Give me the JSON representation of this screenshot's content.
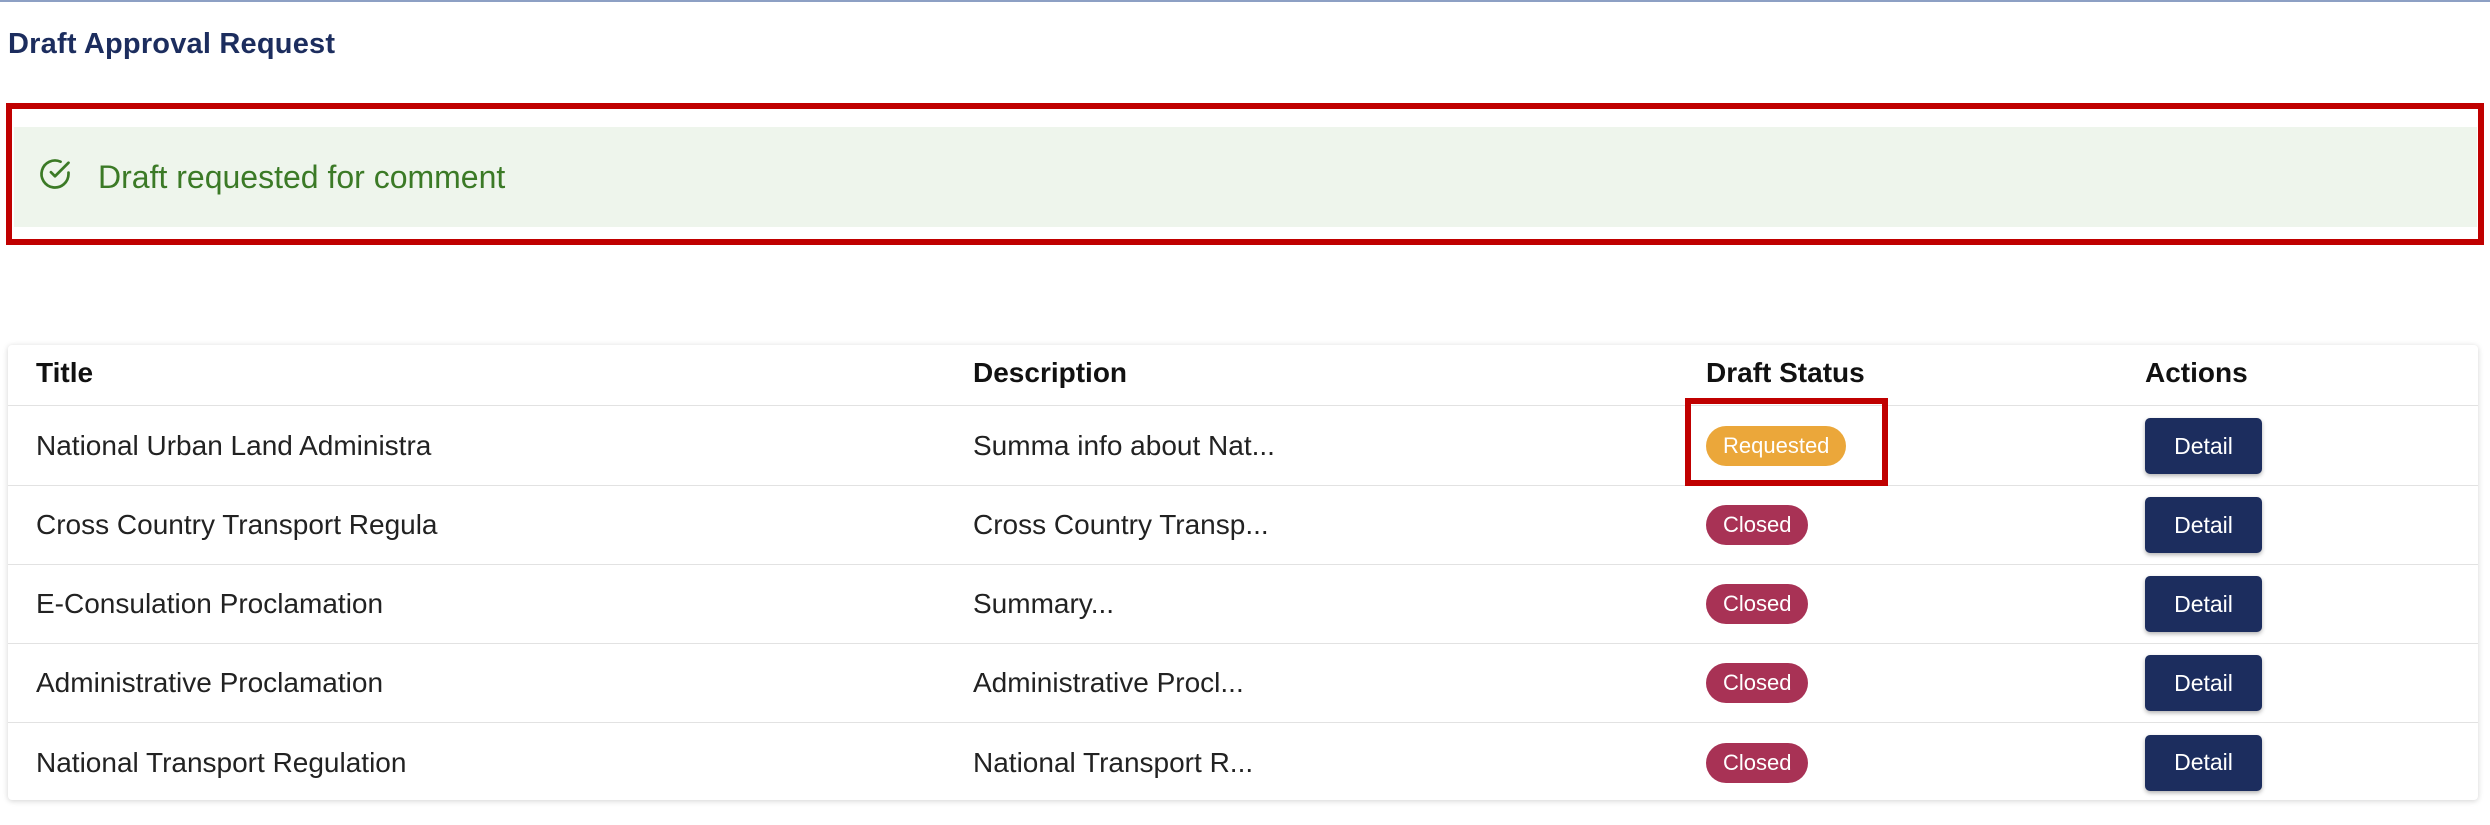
{
  "page": {
    "title": "Draft Approval Request"
  },
  "alert": {
    "message": "Draft requested for comment",
    "icon": "check-circle-icon",
    "color": "#3b7a26",
    "background": "#eef5ec"
  },
  "table": {
    "columns": [
      "Title",
      "Description",
      "Draft Status",
      "Actions"
    ],
    "rows": [
      {
        "title": "National Urban Land Administra",
        "description": "Summa info about Nat...",
        "status": "Requested",
        "action": "Detail"
      },
      {
        "title": "Cross Country Transport Regula",
        "description": "Cross Country Transp...",
        "status": "Closed",
        "action": "Detail"
      },
      {
        "title": "E-Consulation Proclamation",
        "description": "Summary...",
        "status": "Closed",
        "action": "Detail"
      },
      {
        "title": "Administrative Proclamation",
        "description": "Administrative Procl...",
        "status": "Closed",
        "action": "Detail"
      },
      {
        "title": "National Transport Regulation",
        "description": "National Transport R...",
        "status": "Closed",
        "action": "Detail"
      }
    ]
  },
  "colors": {
    "primary": "#1c2d5e",
    "requested": "#eba73a",
    "closed": "#a83255",
    "highlight": "#c00000"
  }
}
